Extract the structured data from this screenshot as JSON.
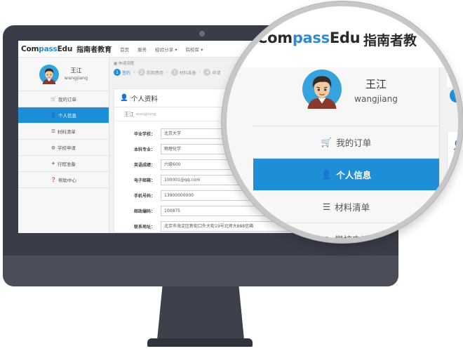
{
  "brand": {
    "logo_prefix": "Com",
    "logo_accent": "pass",
    "logo_suffix": "Edu",
    "logo_cn": "指南者教育",
    "accent_color": "#1e8fd6"
  },
  "nav": {
    "items": [
      "首页",
      "服务",
      "经验分享 ▾",
      "院校库 ▾"
    ]
  },
  "user": {
    "name": "王江",
    "username": "wangjiang"
  },
  "sidebar": {
    "items": [
      {
        "label": "我的订单",
        "icon": "cart-icon"
      },
      {
        "label": "个人信息",
        "icon": "user-icon",
        "active": true
      },
      {
        "label": "材料清单",
        "icon": "list-icon"
      },
      {
        "label": "学校申请",
        "icon": "globe-icon"
      },
      {
        "label": "行程准备",
        "icon": "plane-icon"
      },
      {
        "label": "帮助中心",
        "icon": "help-icon"
      }
    ]
  },
  "breadcrumb": "申请流程",
  "steps": [
    {
      "num": "1",
      "label": "签约",
      "active": true
    },
    {
      "num": "2",
      "label": "前期费用"
    },
    {
      "num": "3",
      "label": "材料准备"
    },
    {
      "num": "4",
      "label": "申请"
    }
  ],
  "profile_card": {
    "title": "个人资料",
    "user_name": "王江",
    "user_sub": "wangjiang",
    "fields": [
      {
        "label": "毕业学校：",
        "value": "北京大学"
      },
      {
        "label": "本科专业：",
        "value": "物理化学"
      },
      {
        "label": "英语成绩：",
        "value": "六级600"
      },
      {
        "label": "电子邮箱：",
        "value": "100001@qq.com"
      },
      {
        "label": "手机号码：",
        "value": "13900000000"
      },
      {
        "label": "邮政编码：",
        "value": "100875"
      },
      {
        "label": "联系地址：",
        "value": "北京市海淀区新街口外大街19号北师大888信箱"
      }
    ]
  },
  "zoom": {
    "logo_cn": "指南者教"
  }
}
